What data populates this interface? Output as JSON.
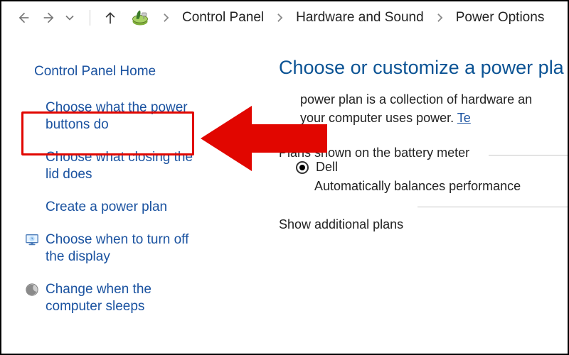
{
  "breadcrumb": {
    "items": [
      "Control Panel",
      "Hardware and Sound",
      "Power Options"
    ]
  },
  "sidebar": {
    "home": "Control Panel Home",
    "items": [
      {
        "label": "Choose what the power buttons do",
        "icon": null,
        "highlight": true
      },
      {
        "label": "Choose what closing the lid does",
        "icon": null
      },
      {
        "label": "Create a power plan",
        "icon": null
      },
      {
        "label": "Choose when to turn off the display",
        "icon": "monitor-icon"
      },
      {
        "label": "Change when the computer sleeps",
        "icon": "moon-icon"
      }
    ]
  },
  "main": {
    "heading": "Choose or customize a power pla",
    "para_line1": "power plan is a collection of hardware an",
    "para_line2": "your computer uses power. ",
    "para_link": "Te",
    "plans_header": "Plans shown on the battery meter",
    "plan_name": "Dell",
    "plan_desc": "Automatically balances performance ",
    "show_more": "Show additional plans"
  },
  "annotation": {
    "arrow_color": "#e10600"
  }
}
